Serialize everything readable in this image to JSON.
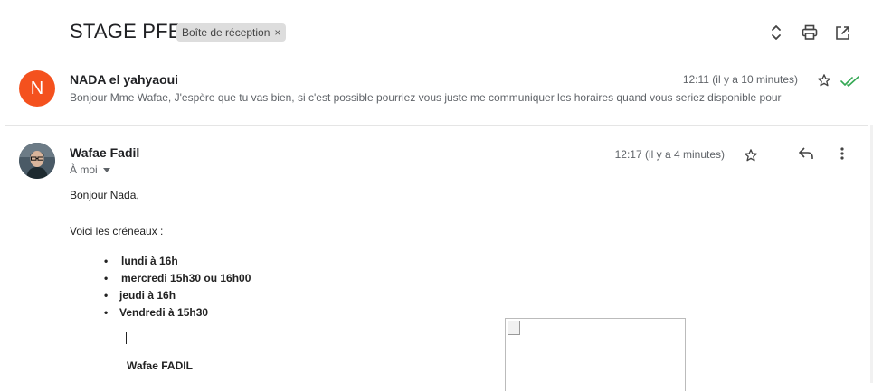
{
  "thread": {
    "subject": "STAGE PFE",
    "label": "Boîte de réception",
    "label_remove": "×"
  },
  "toolbar": {
    "icons": [
      "expand-collapse-icon",
      "print-icon",
      "open-new-window-icon"
    ]
  },
  "message1": {
    "avatar_letter": "N",
    "avatar_color": "#f4511e",
    "sender": "NADA el yahyaoui",
    "time": "12:11 (il y a 10 minutes)",
    "snippet": "Bonjour Mme Wafae, J'espère que tu vas bien, si c'est possible pourriez vous juste me communiquer les horaires quand vous seriez disponible pour",
    "status_color": "#34a853"
  },
  "message2": {
    "sender": "Wafae Fadil",
    "to": "À moi",
    "time": "12:17 (il y a 4 minutes)",
    "greeting": "Bonjour Nada,",
    "intro": "Voici les créneaux :",
    "slots": [
      " lundi à 16h",
      " mercredi 15h30 ou 16h00",
      "jeudi à 16h",
      "Vendredi à 15h30"
    ],
    "signature": "Wafae FADIL"
  }
}
